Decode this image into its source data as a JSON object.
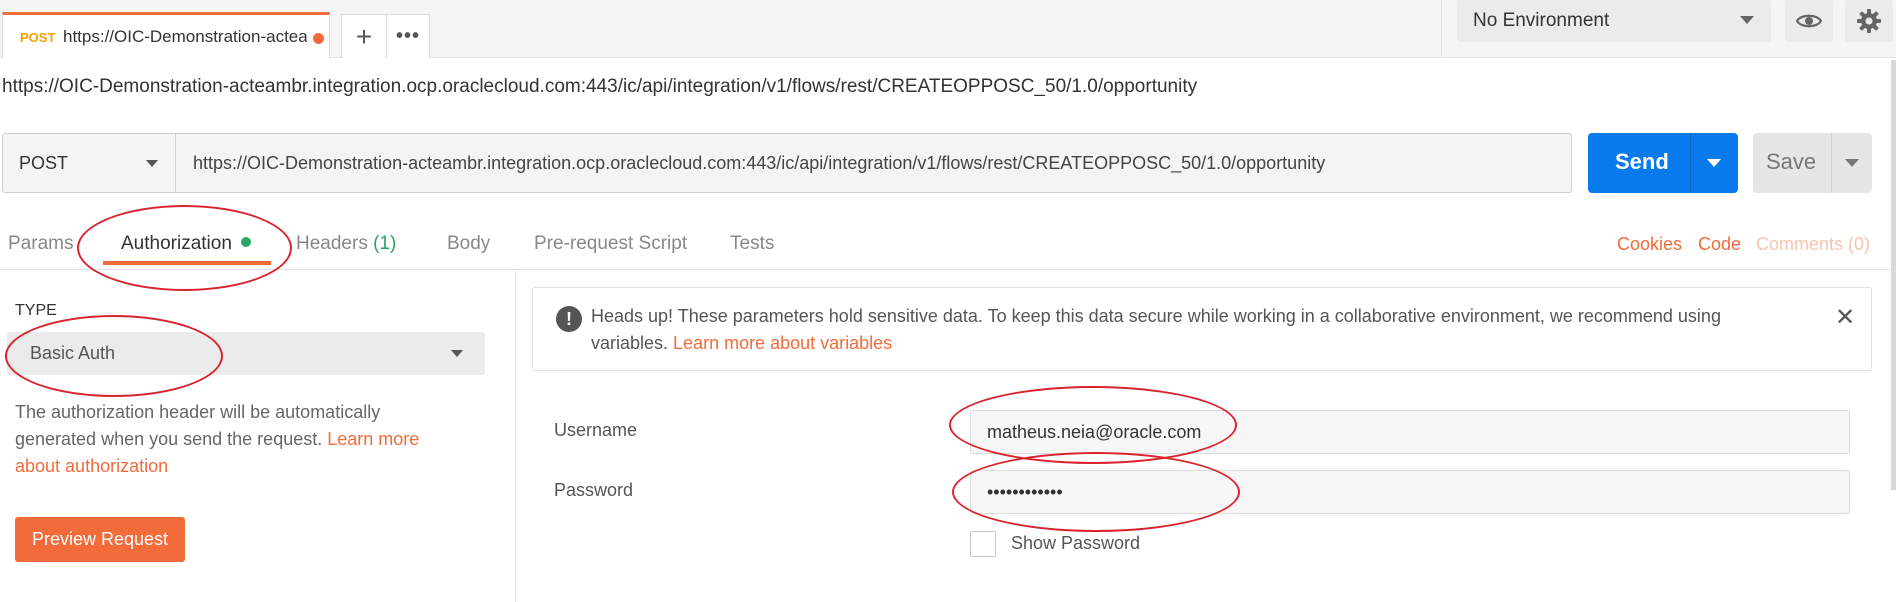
{
  "tab": {
    "method": "POST",
    "url_short": "https://OIC-Demonstration-acteambr.integration.ocp.oraclecloud.com:443/ic/api/integration/v1/flows/rest/CREATEOPPOSC_50/1.0/opportunity",
    "plus": "+",
    "more": "•••"
  },
  "environment": {
    "selected": "No Environment"
  },
  "request_title": "https://OIC-Demonstration-acteambr.integration.ocp.oraclecloud.com:443/ic/api/integration/v1/flows/rest/CREATEOPPOSC_50/1.0/opportunity",
  "url_bar": {
    "method": "POST",
    "url": "https://OIC-Demonstration-acteambr.integration.ocp.oraclecloud.com:443/ic/api/integration/v1/flows/rest/CREATEOPPOSC_50/1.0/opportunity",
    "send_label": "Send",
    "save_label": "Save"
  },
  "subtabs": {
    "params": "Params",
    "authorization": "Authorization",
    "headers": "Headers",
    "headers_count": "(1)",
    "body": "Body",
    "prerequest": "Pre-request Script",
    "tests": "Tests",
    "cookies": "Cookies",
    "code": "Code",
    "comments": "Comments (0)"
  },
  "auth": {
    "type_label": "TYPE",
    "type_value": "Basic Auth",
    "description": "The authorization header will be automatically generated when you send the request. ",
    "learn_link": "Learn more about authorization",
    "preview_label": "Preview Request"
  },
  "notice": {
    "text": "Heads up! These parameters hold sensitive data. To keep this data secure while working in a collaborative environment, we recommend using variables. ",
    "link": "Learn more about variables",
    "icon": "!",
    "close": "✕"
  },
  "form": {
    "username_label": "Username",
    "username_value": "matheus.neia@oracle.com",
    "password_label": "Password",
    "password_value": "••••••••••••",
    "show_password_label": "Show Password"
  },
  "colors": {
    "accent": "#f26b3a",
    "send": "#097bed",
    "success": "#2aa568",
    "annotation": "#d9232d"
  }
}
